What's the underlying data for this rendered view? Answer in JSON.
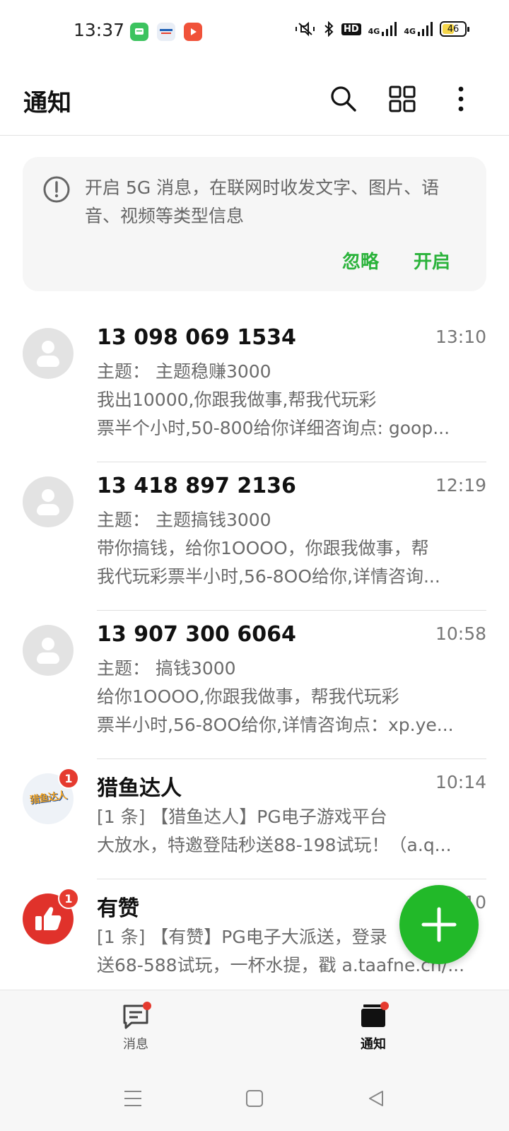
{
  "status_bar": {
    "time": "13:37",
    "hd_label": "HD",
    "signal1_label": "4G",
    "signal2_label": "4G",
    "battery": "46"
  },
  "app_bar": {
    "title": "通知"
  },
  "banner": {
    "text": "开启 5G 消息，在联网时收发文字、图片、语音、视频等类型信息",
    "ignore_label": "忽略",
    "enable_label": "开启"
  },
  "conversations": [
    {
      "title": "13 098 069 1534",
      "time": "13:10",
      "line1": "主题：  主题稳赚3000",
      "line2": "我出10000,你跟我做事,帮我代玩彩",
      "line3": "票半个小时,50-800给你详细咨询点: goop..."
    },
    {
      "title": "13 418 897 2136",
      "time": "12:19",
      "line1": "主题：  主题搞钱3000",
      "line2": "带你搞钱，给你1OOOO，你跟我做事，帮",
      "line3": "我代玩彩票半小时,56-8OO给你,详情咨询..."
    },
    {
      "title": "13 907 300 6064",
      "time": "10:58",
      "line1": "主题：  搞钱3000",
      "line2": "给你1OOOO,你跟我做事，帮我代玩彩",
      "line3": "票半小时,56-8OO给你,详情咨询点：xp.ye..."
    },
    {
      "title": "猎鱼达人",
      "time": "10:14",
      "badge": "1",
      "avatar_text": "猎鱼达人",
      "line1": "[1 条] 【猎鱼达人】PG电子游戏平台",
      "line2": "大放水，特邀登陆秒送88-198试玩！（a.q..."
    },
    {
      "title": "有赞",
      "time": "10:10",
      "badge": "1",
      "line1": "[1 条] 【有赞】PG电子大派送，登录",
      "line2": "送68-588试玩，一杯水提，戳 a.taafne.cn/..."
    }
  ],
  "bottom_nav": {
    "messages_label": "消息",
    "notifications_label": "通知"
  },
  "colors": {
    "accent_green": "#22b929",
    "badge_red": "#e53a2f"
  }
}
